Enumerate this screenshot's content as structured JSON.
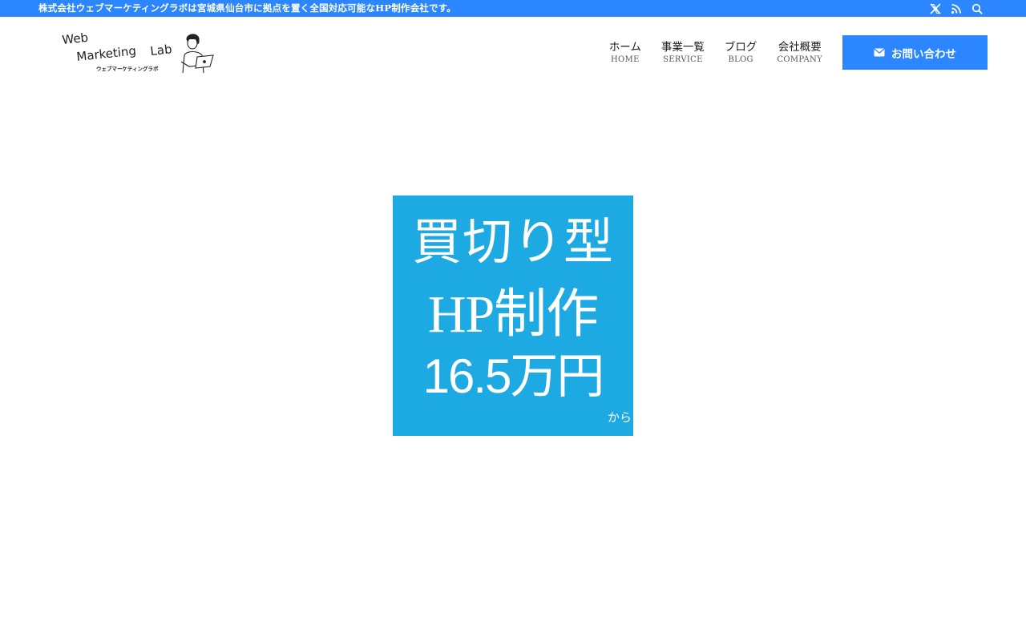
{
  "topbar": {
    "text": "株式会社ウェブマーケティングラボは宮城県仙台市に拠点を置く全国対応可能なHP制作会社です。",
    "icons": [
      "x-icon",
      "rss-icon",
      "search-icon"
    ],
    "background": "#2b86ff"
  },
  "logo": {
    "line1": "Web",
    "line2": "Marketing",
    "line3": "Lab",
    "sub": "ウェブマーケティングラボ"
  },
  "nav": {
    "items": [
      {
        "jp": "ホーム",
        "en": "HOME"
      },
      {
        "jp": "事業一覧",
        "en": "SERVICE"
      },
      {
        "jp": "ブログ",
        "en": "BLOG"
      },
      {
        "jp": "会社概要",
        "en": "COMPANY"
      }
    ],
    "contact_label": "お問い合わせ",
    "contact_icon": "mail-icon",
    "accent": "#2b86ff"
  },
  "banner": {
    "line1": "買切り型",
    "line2": "HP制作",
    "line3": "16.5万円",
    "suffix": "から",
    "background": "#1daae2"
  }
}
